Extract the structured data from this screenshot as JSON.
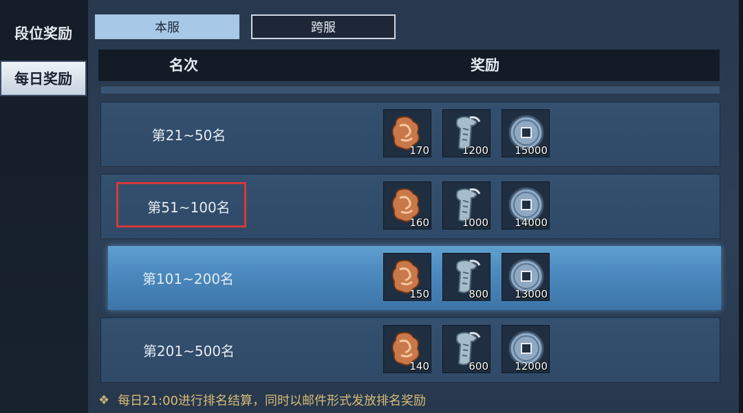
{
  "sidebar": {
    "items": [
      {
        "label": "段位奖励",
        "active": false
      },
      {
        "label": "每日奖励",
        "active": true
      }
    ]
  },
  "tabs": [
    {
      "label": "本服",
      "active": true
    },
    {
      "label": "跨服",
      "active": false
    }
  ],
  "table": {
    "headers": {
      "rank": "名次",
      "reward": "奖励"
    },
    "rows": [
      {
        "rank": "第21~50名",
        "rewards": [
          "170",
          "1200",
          "15000"
        ],
        "highlight": false,
        "marked": false
      },
      {
        "rank": "第51~100名",
        "rewards": [
          "160",
          "1000",
          "14000"
        ],
        "highlight": false,
        "marked": true
      },
      {
        "rank": "第101~200名",
        "rewards": [
          "150",
          "800",
          "13000"
        ],
        "highlight": true,
        "marked": false
      },
      {
        "rank": "第201~500名",
        "rewards": [
          "140",
          "600",
          "12000"
        ],
        "highlight": false,
        "marked": false
      }
    ],
    "reward_icons": [
      "token-icon",
      "scroll-icon",
      "coin-icon"
    ]
  },
  "footer": {
    "bullet": "❖",
    "note": "每日21:00进行排名结算，同时以邮件形式发放排名奖励"
  },
  "colors": {
    "accent_tab": "#a7c8e6",
    "highlight_row": "#4a88bd",
    "note_text": "#d8bb78",
    "marker": "#d8393a"
  }
}
